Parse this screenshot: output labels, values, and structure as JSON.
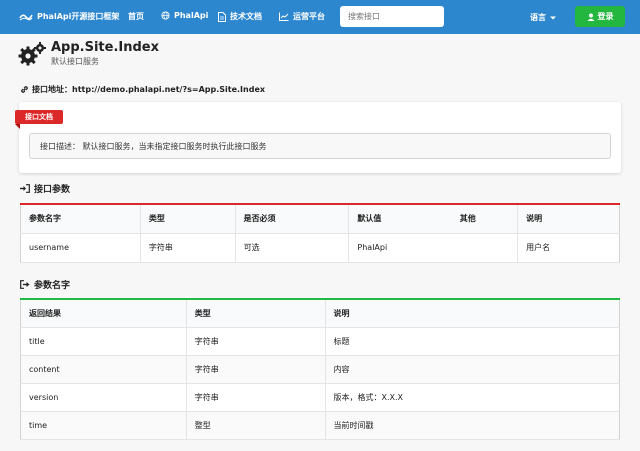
{
  "navbar": {
    "brand": "PhalApi开源接口框架",
    "items": [
      "首页",
      "PhalApi",
      "技术文档",
      "运营平台"
    ],
    "search_placeholder": "搜索接口",
    "language": "语言",
    "login": "登录"
  },
  "page": {
    "title": "App.Site.Index",
    "subtitle": "默认接口服务",
    "url_label": "接口地址：",
    "url": "http://demo.phalapi.net/?s=App.Site.Index"
  },
  "doc": {
    "ribbon": "接口文档",
    "description": "接口描述：  默认接口服务，当未指定接口服务时执行此接口服务"
  },
  "params": {
    "section_title": "接口参数",
    "headers": [
      "参数名字",
      "类型",
      "是否必须",
      "默认值",
      "其他",
      "说明"
    ],
    "rows": [
      [
        "username",
        "字符串",
        "可选",
        "PhalApi",
        "",
        "用户名"
      ]
    ]
  },
  "returns": {
    "section_title": "参数名字",
    "headers": [
      "返回结果",
      "类型",
      "说明"
    ],
    "rows": [
      [
        "title",
        "字符串",
        "标题"
      ],
      [
        "content",
        "字符串",
        "内容"
      ],
      [
        "version",
        "字符串",
        "版本，格式：X.X.X"
      ],
      [
        "time",
        "整型",
        "当前时间戳"
      ]
    ]
  },
  "colors": {
    "navbar": "#2d87cf",
    "login": "#23b73f",
    "params_accent": "#db2828",
    "returns_accent": "#21ba45"
  }
}
